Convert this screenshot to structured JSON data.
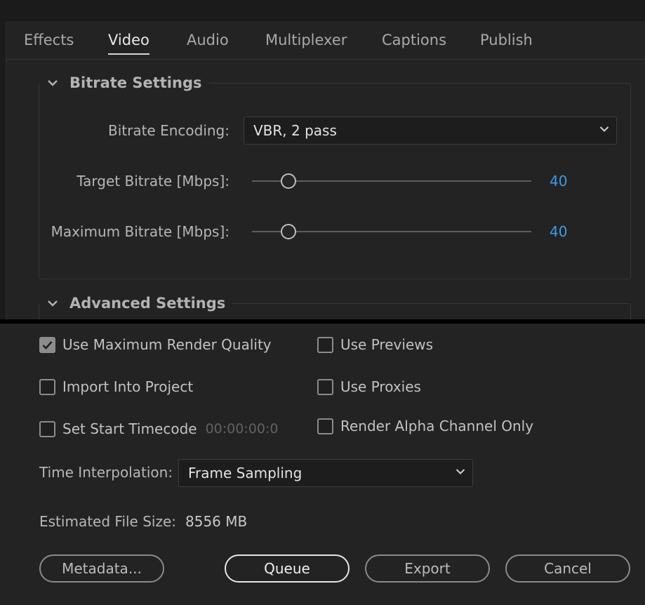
{
  "tabs": [
    {
      "label": "Effects"
    },
    {
      "label": "Video",
      "active": true
    },
    {
      "label": "Audio"
    },
    {
      "label": "Multiplexer"
    },
    {
      "label": "Captions"
    },
    {
      "label": "Publish"
    }
  ],
  "bitrate_settings": {
    "title": "Bitrate Settings",
    "encoding_label": "Bitrate Encoding:",
    "encoding_value": "VBR, 2 pass",
    "target_label": "Target Bitrate [Mbps]:",
    "target_value": "40",
    "max_label": "Maximum Bitrate [Mbps]:",
    "max_value": "40"
  },
  "advanced_settings": {
    "title": "Advanced Settings"
  },
  "options": {
    "max_render_quality": {
      "label": "Use Maximum Render Quality",
      "checked": true
    },
    "use_previews": {
      "label": "Use Previews",
      "checked": false
    },
    "import_into_project": {
      "label": "Import Into Project",
      "checked": false
    },
    "use_proxies": {
      "label": "Use Proxies",
      "checked": false
    },
    "set_start_timecode": {
      "label": "Set Start Timecode",
      "checked": false,
      "timecode": "00:00:00:0"
    },
    "render_alpha_only": {
      "label": "Render Alpha Channel Only",
      "checked": false
    }
  },
  "time_interpolation": {
    "label": "Time Interpolation:",
    "value": "Frame Sampling"
  },
  "estimated_file_size": {
    "label": "Estimated File Size:",
    "value": "8556 MB"
  },
  "buttons": {
    "metadata": "Metadata...",
    "queue": "Queue",
    "export": "Export",
    "cancel": "Cancel"
  },
  "icons": {
    "expand": "chevron-down-icon",
    "check": "checkmark-icon"
  },
  "colors": {
    "accent_value": "#3f9ae6",
    "background": "#232323"
  }
}
